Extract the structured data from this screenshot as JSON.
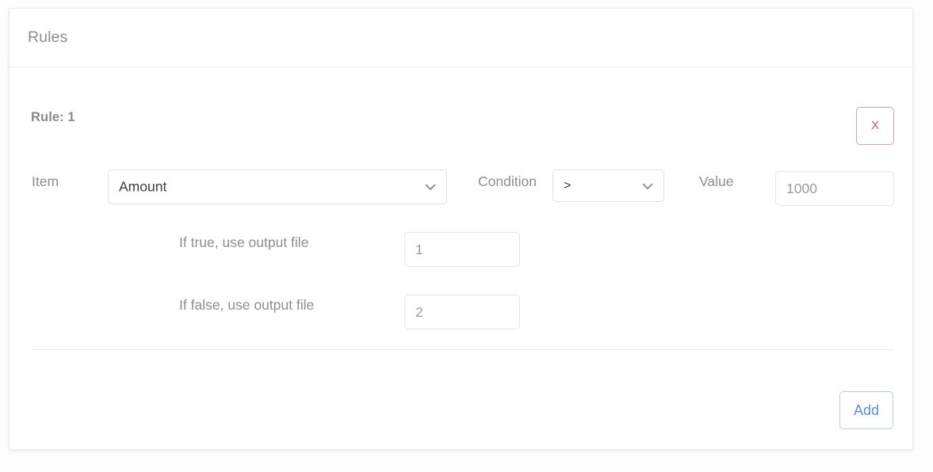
{
  "card": {
    "header": {
      "title": "Rules"
    },
    "rule": {
      "title": "Rule: 1",
      "remove_label": "X",
      "fields": {
        "item": {
          "label": "Item",
          "value": "Amount",
          "icon": "chevron-down-icon"
        },
        "condition": {
          "label": "Condition",
          "value": ">",
          "icon": "chevron-down-icon"
        },
        "value": {
          "label": "Value",
          "value": "1000"
        },
        "if_true": {
          "label": "If true, use output file",
          "value": "1"
        },
        "if_false": {
          "label": "If false, use output file",
          "value": "2"
        }
      }
    },
    "footer": {
      "add_label": "Add"
    }
  },
  "colors": {
    "remove_border": "#e3a0ac",
    "remove_text": "#c9566e",
    "add_border": "#b9cdec",
    "add_text": "#5b8fdb",
    "label_text": "#8e8e8e",
    "input_text": "#9b9b9b",
    "card_border": "#ececec"
  }
}
